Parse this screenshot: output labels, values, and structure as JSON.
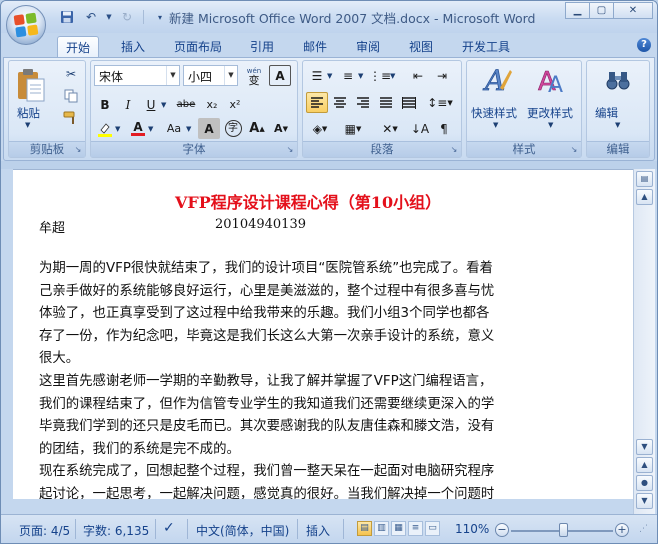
{
  "window": {
    "title": "新建 Microsoft Office Word 2007 文档.docx - Microsoft Word"
  },
  "tabs": [
    "开始",
    "插入",
    "页面布局",
    "引用",
    "邮件",
    "审阅",
    "视图",
    "开发工具"
  ],
  "active_tab": "开始",
  "ribbon": {
    "clipboard": {
      "label": "剪贴板",
      "paste_label": "粘贴"
    },
    "font": {
      "label": "字体",
      "font_name": "宋体",
      "font_size": "小四",
      "wen_glyph": "wén",
      "wen_char": "变",
      "a_char": "A",
      "bold": "B",
      "italic": "I",
      "underline": "U",
      "strike": "abe",
      "subscript": "x₂",
      "superscript": "x²",
      "case": "Aa",
      "shade": "A",
      "circle": "字",
      "grow": "A",
      "shrink": "A"
    },
    "paragraph": {
      "label": "段落"
    },
    "styles": {
      "label": "样式",
      "quick_styles": "快速样式",
      "change_styles": "更改样式"
    },
    "editing": {
      "label": "编辑",
      "label_top": "编辑"
    }
  },
  "document": {
    "title": "VFP程序设计课程心得（第10小组）",
    "author": "牟超",
    "student_id": "20104940139",
    "lines": [
      "为期一周的VFP很快就结束了，我们的设计项目“医院管系统”也完成了。看着",
      "己亲手做好的系统能够良好运行，心里是美滋滋的，整个过程中有很多喜与忧",
      "体验了，也正真享受到了这过程中给我带来的乐趣。我们小组3个同学也都各",
      "存了一份，作为纪念吧，毕竟这是我们长这么大第一次亲手设计的系统，意义",
      "很大。",
      "这里首先感谢老师一学期的辛勤教导，让我了解并掌握了VFP这门编程语言，",
      "我们的课程结束了，但作为信管专业学生的我知道我们还需要继续更深入的学",
      "毕竟我们学到的还只是皮毛而已。其次要感谢我的队友唐佳森和滕文浩，没有",
      "的团结，我们的系统是完不成的。",
      "现在系统完成了，回想起整个过程，我们曾一整天呆在一起面对电脑研究程序",
      "起讨论，一起思考，一起解决问题，感觉真的很好。当我们解决掉一个问题时"
    ]
  },
  "statusbar": {
    "page": "页面: 4/5",
    "words": "字数: 6,135",
    "language": "中文(简体，中国)",
    "mode": "插入",
    "zoom": "110%",
    "zoom_minus": "−",
    "zoom_plus": "+"
  }
}
